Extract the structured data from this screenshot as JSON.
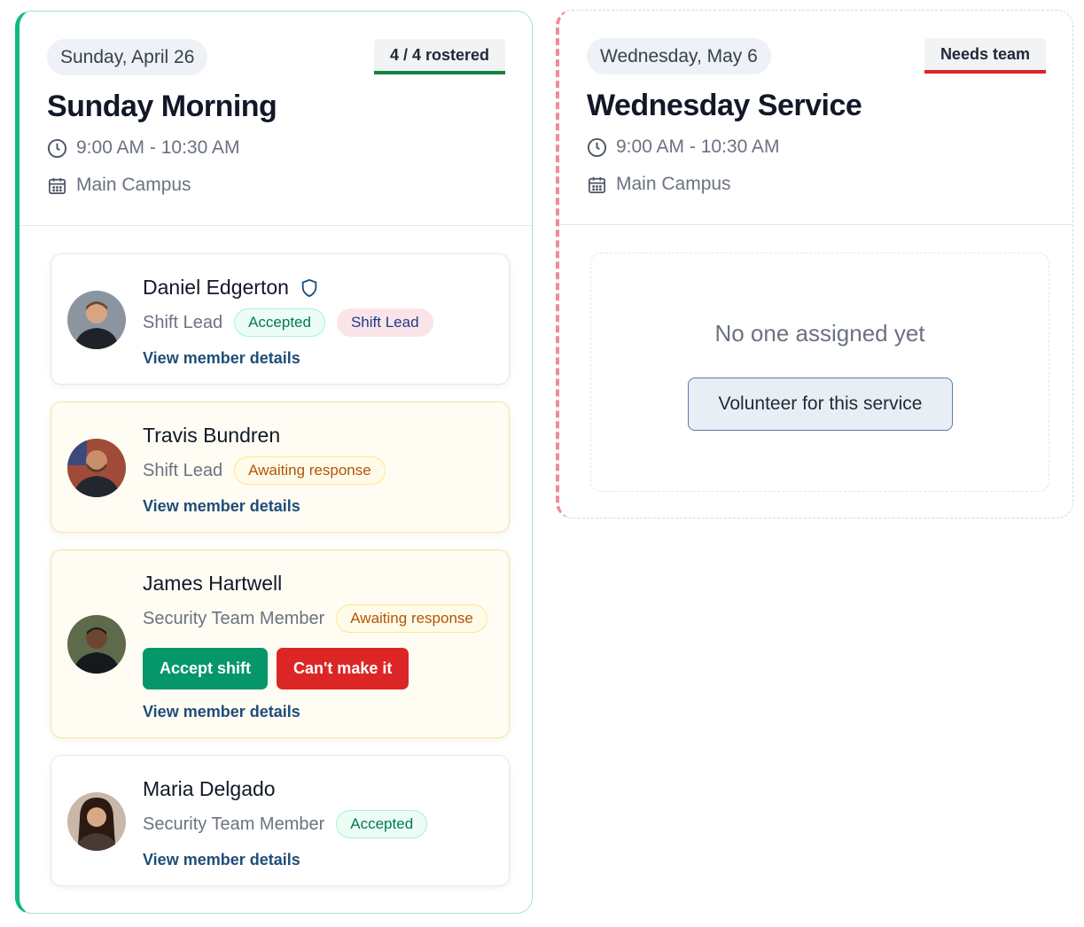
{
  "services": [
    {
      "date": "Sunday, April 26",
      "status": "4 / 4 rostered",
      "status_color": "#15803d",
      "title": "Sunday Morning",
      "time": "9:00 AM - 10:30 AM",
      "location": "Main Campus",
      "members": [
        {
          "name": "Daniel Edgerton",
          "role": "Shift Lead",
          "status": "Accepted",
          "extra_badge": "Shift Lead",
          "link": "View member details"
        },
        {
          "name": "Travis Bundren",
          "role": "Shift Lead",
          "status": "Awaiting response",
          "link": "View member details"
        },
        {
          "name": "James Hartwell",
          "role": "Security Team Member",
          "status": "Awaiting response",
          "accept_label": "Accept shift",
          "decline_label": "Can't make it",
          "link": "View member details"
        },
        {
          "name": "Maria Delgado",
          "role": "Security Team Member",
          "status": "Accepted",
          "link": "View member details"
        }
      ]
    },
    {
      "date": "Wednesday, May 6",
      "status": "Needs team",
      "status_color": "#dc2626",
      "title": "Wednesday Service",
      "time": "9:00 AM - 10:30 AM",
      "location": "Main Campus",
      "empty_text": "No one assigned yet",
      "volunteer_label": "Volunteer for this service"
    }
  ],
  "icons": {
    "time": "clock-icon",
    "location": "calendar-icon",
    "lead": "shield-icon"
  },
  "colors": {
    "accent_green": "#10b981",
    "accent_red": "#f28a9a",
    "link": "#1e4e79"
  }
}
